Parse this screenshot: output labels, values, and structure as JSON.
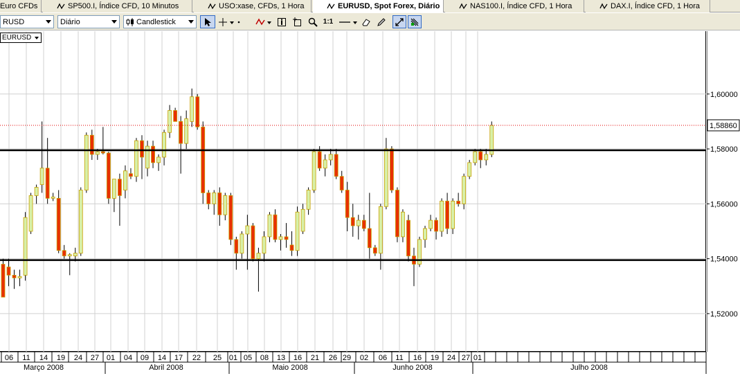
{
  "tabs": [
    {
      "label": "Euro CFDs",
      "active": false
    },
    {
      "label": "SP500.I, Índice CFD, 10 Minutos",
      "active": false
    },
    {
      "label": "USO:xase, CFDs, 1 Hora",
      "active": false
    },
    {
      "label": "EURUSD, Spot Forex, Diário",
      "active": true
    },
    {
      "label": "NAS100.I, Índice CFD, 1 Hora",
      "active": false
    },
    {
      "label": "DAX.I, Índice CFD, 1 Hora",
      "active": false
    }
  ],
  "toolbar": {
    "symbol_value": "RUSD",
    "timeframe_value": "Diário",
    "chart_type_value": "Candlestick",
    "zoom_reset_label": "1:1"
  },
  "symbol_badge": "EURUSD",
  "colors": {
    "bull_body": "#d8f0a8",
    "bear_body": "#e83000",
    "wick": "#000000",
    "outline": "#c8a000",
    "current_price_line": "#e00000",
    "grid": "#d0d0d0",
    "window_bg": "#ece9d8"
  },
  "icons": [
    "chart-tab-icon",
    "cursor-icon",
    "crosshair-icon",
    "indicator-icon",
    "object-icon",
    "zoom-in-icon",
    "zoom-icon",
    "line-icon",
    "eraser-icon",
    "autoscroll-icon",
    "shift-icon"
  ],
  "chart_data": {
    "type": "candlestick",
    "symbol": "EURUSD",
    "timeframe": "Diário",
    "ylim": [
      1.5,
      1.62
    ],
    "y_ticks": [
      "1,52000",
      "1,54000",
      "1,56000",
      "1,58000",
      "1,60000"
    ],
    "current_price_label": "1,58860",
    "current_price": 1.5886,
    "horizontal_lines": [
      1.5795,
      1.5395
    ],
    "x_tick_labels": [
      "06",
      "11",
      "14",
      "19",
      "24",
      "27",
      "01",
      "04",
      "09",
      "14",
      "17",
      "22",
      "25",
      "01",
      "05",
      "08",
      "13",
      "16",
      "21",
      "26",
      "29",
      "02",
      "06",
      "11",
      "16",
      "19",
      "24",
      "27",
      "01"
    ],
    "month_labels": [
      "Março 2008",
      "Abril 2008",
      "Maio 2008",
      "Junho 2008",
      "Julho 2008"
    ],
    "candles": [
      {
        "o": 1.538,
        "h": 1.54,
        "l": 1.527,
        "c": 1.526
      },
      {
        "o": 1.537,
        "h": 1.54,
        "l": 1.53,
        "c": 1.534
      },
      {
        "o": 1.534,
        "h": 1.536,
        "l": 1.529,
        "c": 1.533
      },
      {
        "o": 1.533,
        "h": 1.536,
        "l": 1.53,
        "c": 1.5335
      },
      {
        "o": 1.534,
        "h": 1.557,
        "l": 1.532,
        "c": 1.555
      },
      {
        "o": 1.55,
        "h": 1.564,
        "l": 1.549,
        "c": 1.563
      },
      {
        "o": 1.563,
        "h": 1.567,
        "l": 1.56,
        "c": 1.566
      },
      {
        "o": 1.567,
        "h": 1.59,
        "l": 1.564,
        "c": 1.573
      },
      {
        "o": 1.573,
        "h": 1.584,
        "l": 1.56,
        "c": 1.562
      },
      {
        "o": 1.562,
        "h": 1.564,
        "l": 1.561,
        "c": 1.5625
      },
      {
        "o": 1.562,
        "h": 1.565,
        "l": 1.542,
        "c": 1.543
      },
      {
        "o": 1.543,
        "h": 1.545,
        "l": 1.54,
        "c": 1.541
      },
      {
        "o": 1.541,
        "h": 1.542,
        "l": 1.534,
        "c": 1.5415
      },
      {
        "o": 1.541,
        "h": 1.544,
        "l": 1.539,
        "c": 1.542
      },
      {
        "o": 1.542,
        "h": 1.566,
        "l": 1.541,
        "c": 1.565
      },
      {
        "o": 1.565,
        "h": 1.586,
        "l": 1.564,
        "c": 1.585
      },
      {
        "o": 1.585,
        "h": 1.587,
        "l": 1.576,
        "c": 1.578
      },
      {
        "o": 1.578,
        "h": 1.58,
        "l": 1.576,
        "c": 1.579
      },
      {
        "o": 1.579,
        "h": 1.588,
        "l": 1.578,
        "c": 1.5785
      },
      {
        "o": 1.5785,
        "h": 1.579,
        "l": 1.56,
        "c": 1.562
      },
      {
        "o": 1.562,
        "h": 1.568,
        "l": 1.557,
        "c": 1.569
      },
      {
        "o": 1.569,
        "h": 1.571,
        "l": 1.552,
        "c": 1.563
      },
      {
        "o": 1.565,
        "h": 1.574,
        "l": 1.562,
        "c": 1.572
      },
      {
        "o": 1.571,
        "h": 1.573,
        "l": 1.569,
        "c": 1.57
      },
      {
        "o": 1.57,
        "h": 1.584,
        "l": 1.568,
        "c": 1.583
      },
      {
        "o": 1.583,
        "h": 1.585,
        "l": 1.569,
        "c": 1.577
      },
      {
        "o": 1.573,
        "h": 1.583,
        "l": 1.57,
        "c": 1.581
      },
      {
        "o": 1.581,
        "h": 1.583,
        "l": 1.573,
        "c": 1.575
      },
      {
        "o": 1.575,
        "h": 1.578,
        "l": 1.572,
        "c": 1.577
      },
      {
        "o": 1.577,
        "h": 1.587,
        "l": 1.574,
        "c": 1.586
      },
      {
        "o": 1.586,
        "h": 1.596,
        "l": 1.584,
        "c": 1.594
      },
      {
        "o": 1.594,
        "h": 1.595,
        "l": 1.59,
        "c": 1.59
      },
      {
        "o": 1.59,
        "h": 1.592,
        "l": 1.571,
        "c": 1.582
      },
      {
        "o": 1.582,
        "h": 1.594,
        "l": 1.58,
        "c": 1.591
      },
      {
        "o": 1.59,
        "h": 1.602,
        "l": 1.588,
        "c": 1.599
      },
      {
        "o": 1.599,
        "h": 1.6,
        "l": 1.587,
        "c": 1.588
      },
      {
        "o": 1.588,
        "h": 1.59,
        "l": 1.56,
        "c": 1.564
      },
      {
        "o": 1.564,
        "h": 1.565,
        "l": 1.558,
        "c": 1.56
      },
      {
        "o": 1.56,
        "h": 1.565,
        "l": 1.556,
        "c": 1.564
      },
      {
        "o": 1.564,
        "h": 1.566,
        "l": 1.552,
        "c": 1.556
      },
      {
        "o": 1.556,
        "h": 1.564,
        "l": 1.554,
        "c": 1.563
      },
      {
        "o": 1.563,
        "h": 1.564,
        "l": 1.545,
        "c": 1.547
      },
      {
        "o": 1.547,
        "h": 1.548,
        "l": 1.536,
        "c": 1.542
      },
      {
        "o": 1.542,
        "h": 1.55,
        "l": 1.54,
        "c": 1.549
      },
      {
        "o": 1.549,
        "h": 1.556,
        "l": 1.536,
        "c": 1.552
      },
      {
        "o": 1.552,
        "h": 1.553,
        "l": 1.539,
        "c": 1.54
      },
      {
        "o": 1.54,
        "h": 1.544,
        "l": 1.528,
        "c": 1.542
      },
      {
        "o": 1.542,
        "h": 1.55,
        "l": 1.539,
        "c": 1.548
      },
      {
        "o": 1.548,
        "h": 1.557,
        "l": 1.546,
        "c": 1.556
      },
      {
        "o": 1.556,
        "h": 1.558,
        "l": 1.546,
        "c": 1.547
      },
      {
        "o": 1.547,
        "h": 1.549,
        "l": 1.543,
        "c": 1.548
      },
      {
        "o": 1.548,
        "h": 1.553,
        "l": 1.544,
        "c": 1.547
      },
      {
        "o": 1.545,
        "h": 1.55,
        "l": 1.541,
        "c": 1.543
      },
      {
        "o": 1.543,
        "h": 1.559,
        "l": 1.541,
        "c": 1.557
      },
      {
        "o": 1.55,
        "h": 1.56,
        "l": 1.549,
        "c": 1.558
      },
      {
        "o": 1.558,
        "h": 1.566,
        "l": 1.556,
        "c": 1.565
      },
      {
        "o": 1.565,
        "h": 1.58,
        "l": 1.564,
        "c": 1.579
      },
      {
        "o": 1.579,
        "h": 1.581,
        "l": 1.572,
        "c": 1.573
      },
      {
        "o": 1.573,
        "h": 1.578,
        "l": 1.57,
        "c": 1.576
      },
      {
        "o": 1.576,
        "h": 1.58,
        "l": 1.574,
        "c": 1.578
      },
      {
        "o": 1.578,
        "h": 1.58,
        "l": 1.569,
        "c": 1.57
      },
      {
        "o": 1.57,
        "h": 1.572,
        "l": 1.564,
        "c": 1.565
      },
      {
        "o": 1.565,
        "h": 1.568,
        "l": 1.55,
        "c": 1.555
      },
      {
        "o": 1.555,
        "h": 1.56,
        "l": 1.548,
        "c": 1.552
      },
      {
        "o": 1.552,
        "h": 1.556,
        "l": 1.547,
        "c": 1.554
      },
      {
        "o": 1.554,
        "h": 1.556,
        "l": 1.55,
        "c": 1.551
      },
      {
        "o": 1.551,
        "h": 1.564,
        "l": 1.54,
        "c": 1.544
      },
      {
        "o": 1.544,
        "h": 1.545,
        "l": 1.541,
        "c": 1.542
      },
      {
        "o": 1.542,
        "h": 1.56,
        "l": 1.536,
        "c": 1.559
      },
      {
        "o": 1.559,
        "h": 1.584,
        "l": 1.558,
        "c": 1.58
      },
      {
        "o": 1.58,
        "h": 1.581,
        "l": 1.564,
        "c": 1.565
      },
      {
        "o": 1.565,
        "h": 1.566,
        "l": 1.546,
        "c": 1.548
      },
      {
        "o": 1.548,
        "h": 1.558,
        "l": 1.546,
        "c": 1.557
      },
      {
        "o": 1.554,
        "h": 1.556,
        "l": 1.539,
        "c": 1.541
      },
      {
        "o": 1.541,
        "h": 1.544,
        "l": 1.53,
        "c": 1.538
      },
      {
        "o": 1.538,
        "h": 1.548,
        "l": 1.537,
        "c": 1.547
      },
      {
        "o": 1.547,
        "h": 1.552,
        "l": 1.544,
        "c": 1.551
      },
      {
        "o": 1.551,
        "h": 1.556,
        "l": 1.55,
        "c": 1.554
      },
      {
        "o": 1.554,
        "h": 1.555,
        "l": 1.547,
        "c": 1.55
      },
      {
        "o": 1.55,
        "h": 1.562,
        "l": 1.548,
        "c": 1.561
      },
      {
        "o": 1.561,
        "h": 1.564,
        "l": 1.549,
        "c": 1.551
      },
      {
        "o": 1.551,
        "h": 1.562,
        "l": 1.549,
        "c": 1.561
      },
      {
        "o": 1.561,
        "h": 1.564,
        "l": 1.559,
        "c": 1.56
      },
      {
        "o": 1.56,
        "h": 1.571,
        "l": 1.558,
        "c": 1.57
      },
      {
        "o": 1.57,
        "h": 1.576,
        "l": 1.569,
        "c": 1.575
      },
      {
        "o": 1.575,
        "h": 1.58,
        "l": 1.574,
        "c": 1.579
      },
      {
        "o": 1.579,
        "h": 1.58,
        "l": 1.573,
        "c": 1.576
      },
      {
        "o": 1.576,
        "h": 1.58,
        "l": 1.574,
        "c": 1.578
      },
      {
        "o": 1.578,
        "h": 1.59,
        "l": 1.577,
        "c": 1.5886
      }
    ]
  }
}
